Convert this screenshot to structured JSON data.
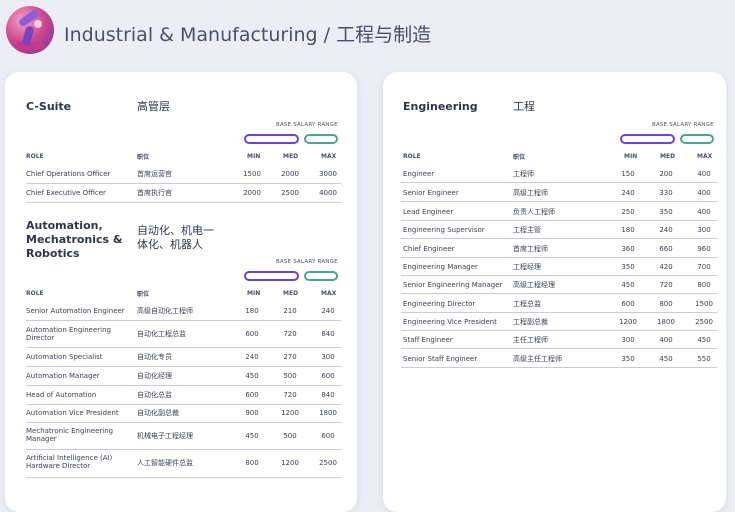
{
  "header": {
    "title": "Industrial & Manufacturing / 工程与制造"
  },
  "columns": {
    "role": "ROLE",
    "role_zh": "职位",
    "min": "MIN",
    "med": "MED",
    "max": "MAX",
    "range_label": "BASE SALARY RANGE"
  },
  "colors": {
    "purple_pill": "#6d3fe0",
    "green_pill": "#4ea58f"
  },
  "left": {
    "sections": [
      {
        "title_en": "C-Suite",
        "title_zh": "高管层",
        "rows": [
          {
            "en": "Chief Operations Officer",
            "zh": "首席运营官",
            "min": "1500",
            "med": "2000",
            "max": "3000"
          },
          {
            "en": "Chief Executive Officer",
            "zh": "首席执行官",
            "min": "2000",
            "med": "2500",
            "max": "4000"
          }
        ]
      },
      {
        "title_en": "Automation, Mechatronics & Robotics",
        "title_zh": "自动化、机电一体化、机器人",
        "rows": [
          {
            "en": "Senior Automation Engineer",
            "zh": "高级自动化工程师",
            "min": "180",
            "med": "210",
            "max": "240"
          },
          {
            "en": "Automation Engineering Director",
            "zh": "自动化工程总监",
            "min": "600",
            "med": "720",
            "max": "840"
          },
          {
            "en": "Automation Specialist",
            "zh": "自动化专员",
            "min": "240",
            "med": "270",
            "max": "300"
          },
          {
            "en": "Automation Manager",
            "zh": "自动化经理",
            "min": "450",
            "med": "500",
            "max": "600"
          },
          {
            "en": "Head of Automation",
            "zh": "自动化总监",
            "min": "600",
            "med": "720",
            "max": "840"
          },
          {
            "en": "Automation Vice President",
            "zh": "自动化副总裁",
            "min": "900",
            "med": "1200",
            "max": "1800"
          },
          {
            "en": "Mechatronic Engineering Manager",
            "zh": "机械电子工程经理",
            "min": "450",
            "med": "500",
            "max": "600"
          },
          {
            "en": "Artificial Intelligence (AI) Hardware Director",
            "zh": "人工智能硬件总监",
            "min": "800",
            "med": "1200",
            "max": "2500"
          }
        ]
      }
    ]
  },
  "right": {
    "title_en": "Engineering",
    "title_zh": "工程",
    "rows": [
      {
        "en": "Engineer",
        "zh": "工程师",
        "min": "150",
        "med": "200",
        "max": "400"
      },
      {
        "en": "Senior Engineer",
        "zh": "高级工程师",
        "min": "240",
        "med": "330",
        "max": "400"
      },
      {
        "en": "Lead Engineer",
        "zh": "负责人工程师",
        "min": "250",
        "med": "350",
        "max": "400"
      },
      {
        "en": "Engineering Supervisor",
        "zh": "工程主管",
        "min": "180",
        "med": "240",
        "max": "300"
      },
      {
        "en": "Chief Engineer",
        "zh": "首席工程师",
        "min": "360",
        "med": "660",
        "max": "960"
      },
      {
        "en": "Engineering Manager",
        "zh": "工程经理",
        "min": "350",
        "med": "420",
        "max": "700"
      },
      {
        "en": "Senior Engineering Manager",
        "zh": "高级工程经理",
        "min": "450",
        "med": "720",
        "max": "800"
      },
      {
        "en": "Engineering Director",
        "zh": "工程总监",
        "min": "600",
        "med": "800",
        "max": "1500"
      },
      {
        "en": "Engineering Vice President",
        "zh": "工程副总裁",
        "min": "1200",
        "med": "1800",
        "max": "2500"
      },
      {
        "en": "Staff Engineer",
        "zh": "主任工程师",
        "min": "300",
        "med": "400",
        "max": "450"
      },
      {
        "en": "Senior Staff Engineer",
        "zh": "高级主任工程师",
        "min": "350",
        "med": "450",
        "max": "550"
      }
    ]
  }
}
